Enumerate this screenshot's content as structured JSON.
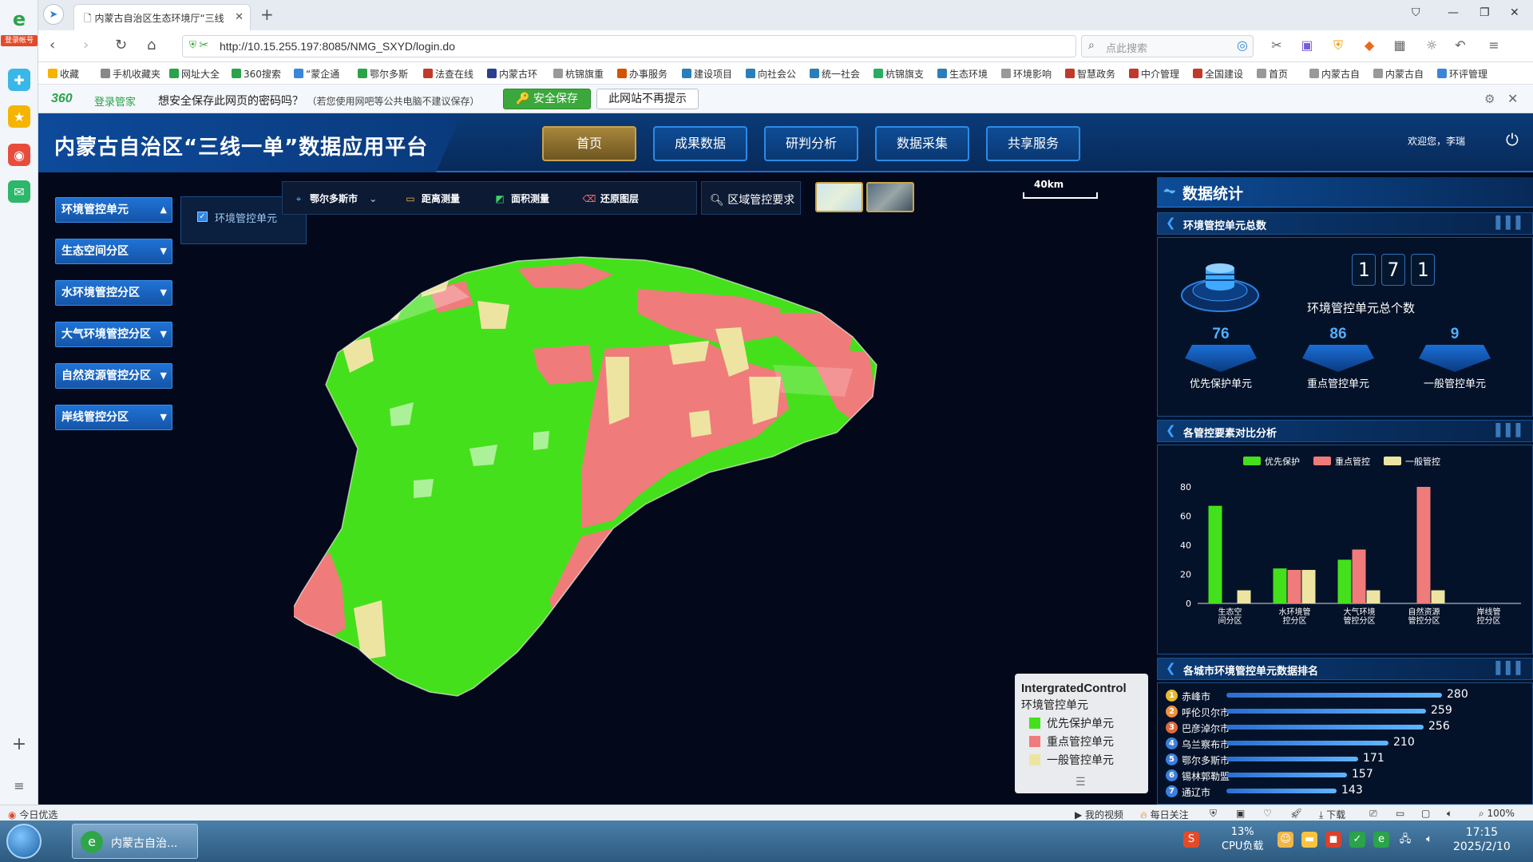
{
  "browser": {
    "side_badge": "登录帐号",
    "tab_title": "内蒙古自治区生态环境厅“三线",
    "url": "http://10.15.255.197:8085/NMG_SXYD/login.do",
    "search_placeholder": "点此搜索",
    "bookmarks": [
      "收藏",
      "手机收藏夹",
      "网址大全",
      "360搜索",
      "“蒙企通",
      "鄂尔多斯",
      "法查在线",
      "内蒙古环",
      "杭锦旗重",
      "办事服务",
      "建设项目",
      "向社会公",
      "统一社会",
      "杭锦旗支",
      "生态环境",
      "环境影响",
      "智慧政务",
      "中介管理",
      "全国建设",
      "首页",
      "内蒙古自",
      "内蒙古自",
      "环评管理"
    ],
    "pwd_brand": "360",
    "pwd_brand2": "登录管家",
    "pwd_question": "想安全保存此网页的密码吗？",
    "pwd_note": "（若您使用网吧等公共电脑不建议保存）",
    "pwd_save": "安全保存",
    "pwd_nomore": "此网站不再提示"
  },
  "app": {
    "title": "内蒙古自治区“三线一单”数据应用平台",
    "nav": [
      "首页",
      "成果数据",
      "研判分析",
      "数据采集",
      "共享服务"
    ],
    "welcome": "欢迎您，李瑞",
    "left_menu": [
      "环境管控单元",
      "生态空间分区",
      "水环境管控分区",
      "大气环境管控分区",
      "自然资源管控分区",
      "岸线管控分区"
    ],
    "sub_layer": "环境管控单元",
    "tools": {
      "city": "鄂尔多斯市",
      "distance": "距离测量",
      "area": "面积测量",
      "restore": "还原图层",
      "region_req": "区域管控要求"
    },
    "scale": "40km",
    "legend": {
      "title": "IntergratedControl",
      "subtitle": "环境管控单元",
      "items": [
        {
          "label": "优先保护单元",
          "color": "#45e01c"
        },
        {
          "label": "重点管控单元",
          "color": "#f07b7b"
        },
        {
          "label": "一般管控单元",
          "color": "#ede4a2"
        }
      ]
    },
    "colors": {
      "priority": "#45e01c",
      "key": "#f07b7b",
      "general": "#ede4a2",
      "accent": "#2d8ae6"
    }
  },
  "stats": {
    "title": "数据统计",
    "sec1": "环境管控单元总数",
    "digits": [
      "1",
      "7",
      "1"
    ],
    "total_label": "环境管控单元总个数",
    "priority": {
      "value": "76",
      "label": "优先保护单元"
    },
    "key": {
      "value": "86",
      "label": "重点管控单元"
    },
    "general": {
      "value": "9",
      "label": "一般管控单元"
    },
    "sec2": "各管控要素对比分析",
    "sec3": "各城市环境管控单元数据排名",
    "ranking": [
      {
        "rank": "1",
        "city": "赤峰市",
        "value": 280
      },
      {
        "rank": "2",
        "city": "呼伦贝尔市",
        "value": 259
      },
      {
        "rank": "3",
        "city": "巴彦淖尔市",
        "value": 256
      },
      {
        "rank": "4",
        "city": "乌兰察布市",
        "value": 210
      },
      {
        "rank": "5",
        "city": "鄂尔多斯市",
        "value": 171
      },
      {
        "rank": "6",
        "city": "锡林郭勒盟",
        "value": 157
      },
      {
        "rank": "7",
        "city": "通辽市",
        "value": 143
      }
    ]
  },
  "chart_data": {
    "type": "bar",
    "categories": [
      "生态空间分区",
      "水环境管控分区",
      "大气环境管控分区",
      "自然资源管控分区",
      "岸线管控分区"
    ],
    "series": [
      {
        "name": "优先保护",
        "color": "#45e01c",
        "values": [
          67,
          24,
          30,
          0,
          0
        ]
      },
      {
        "name": "重点管控",
        "color": "#f07b7b",
        "values": [
          0,
          23,
          37,
          80,
          0
        ]
      },
      {
        "name": "一般管控",
        "color": "#ede4a2",
        "values": [
          9,
          23,
          9,
          9,
          0
        ]
      }
    ],
    "ylim": [
      0,
      80
    ],
    "yticks": [
      0,
      20,
      40,
      60,
      80
    ],
    "legend": "top"
  },
  "status": {
    "left": "今日优选",
    "video": "我的视频",
    "daily": "每日关注",
    "download": "下载",
    "zoom": "100%"
  },
  "taskbar": {
    "app": "内蒙古自治...",
    "cpu_pct": "13%",
    "cpu_label": "CPU负载",
    "time": "17:15",
    "date": "2025/2/10"
  }
}
